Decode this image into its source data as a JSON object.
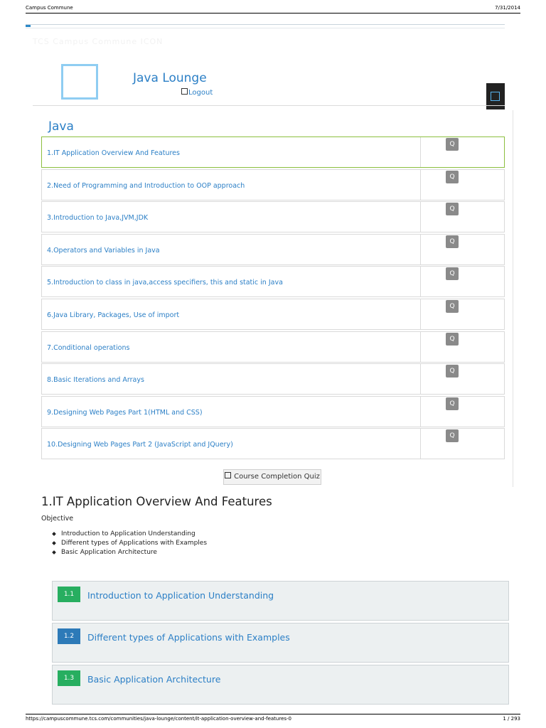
{
  "print_header": {
    "site": "Campus Commune",
    "date": "7/31/2014"
  },
  "header": {
    "ghost_text": "TCS Campus Commune ICON",
    "lounge_title": "Java Lounge",
    "logout_label": "Logout"
  },
  "section": {
    "title": "Java"
  },
  "lessons": [
    {
      "title": "1.IT Application Overview And Features",
      "quiz": "Q"
    },
    {
      "title": "2.Need of Programming and Introduction to OOP approach",
      "quiz": "Q"
    },
    {
      "title": "3.Introduction to Java,JVM,JDK",
      "quiz": "Q"
    },
    {
      "title": "4.Operators and Variables in Java",
      "quiz": "Q"
    },
    {
      "title": "5.Introduction to class in java,access specifiers, this and static in Java",
      "quiz": "Q"
    },
    {
      "title": "6.Java Library, Packages, Use of import",
      "quiz": "Q"
    },
    {
      "title": "7.Conditional operations",
      "quiz": "Q"
    },
    {
      "title": "8.Basic Iterations and Arrays",
      "quiz": "Q"
    },
    {
      "title": "9.Designing Web Pages Part 1(HTML and CSS)",
      "quiz": "Q"
    },
    {
      "title": "10.Designing Web Pages Part 2 (JavaScript and JQuery)",
      "quiz": "Q"
    }
  ],
  "completion_quiz_label": "Course Completion Quiz",
  "content": {
    "title": "1.IT Application Overview And Features",
    "objective_label": "Objective",
    "objectives": [
      "Introduction to Application Understanding",
      "Different types of Applications with Examples",
      "Basic Application Architecture"
    ],
    "topics": [
      {
        "num": "1.1",
        "label": "Introduction to Application Understanding",
        "color": "#27ae60"
      },
      {
        "num": "1.2",
        "label": "Different types of Applications with Examples",
        "color": "#2d7ab8"
      },
      {
        "num": "1.3",
        "label": "Basic Application Architecture",
        "color": "#27ae60"
      }
    ]
  },
  "print_footer": {
    "url": "https://campuscommune.tcs.com/communities/java-lounge/content/it-application-overview-and-features-0",
    "page": "1 / 293"
  },
  "colors": {
    "link": "#2b7fc6",
    "active_border": "#8cbf3f",
    "quiz_badge": "#8a8a8a"
  }
}
